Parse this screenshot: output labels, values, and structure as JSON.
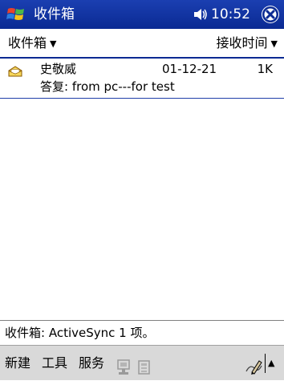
{
  "titlebar": {
    "title": "收件箱",
    "time": "10:52",
    "start_icon": "windows-flag-icon",
    "volume_icon": "speaker-icon",
    "close_icon": "close-circle-icon"
  },
  "filterbar": {
    "folder_label": "收件箱",
    "sort_label": "接收时间",
    "caret": "▼"
  },
  "messages": [
    {
      "sender": "史敬威",
      "date": "01-12-21",
      "size": "1K",
      "subject": "答复: from pc---for test",
      "icon": "open-envelope-icon"
    }
  ],
  "status": {
    "text": "收件箱: ActiveSync  1 项。"
  },
  "menubar": {
    "new_label": "新建",
    "tools_label": "工具",
    "services_label": "服务",
    "send_receive_icon": "send-receive-icon",
    "delete_icon": "delete-icon",
    "sip_icon": "pen-input-icon",
    "sip_arrow": "▲"
  },
  "colors": {
    "titlebar": "#0a2a93",
    "accent_line": "#1f3ea8",
    "menubar": "#d9d9d9"
  }
}
